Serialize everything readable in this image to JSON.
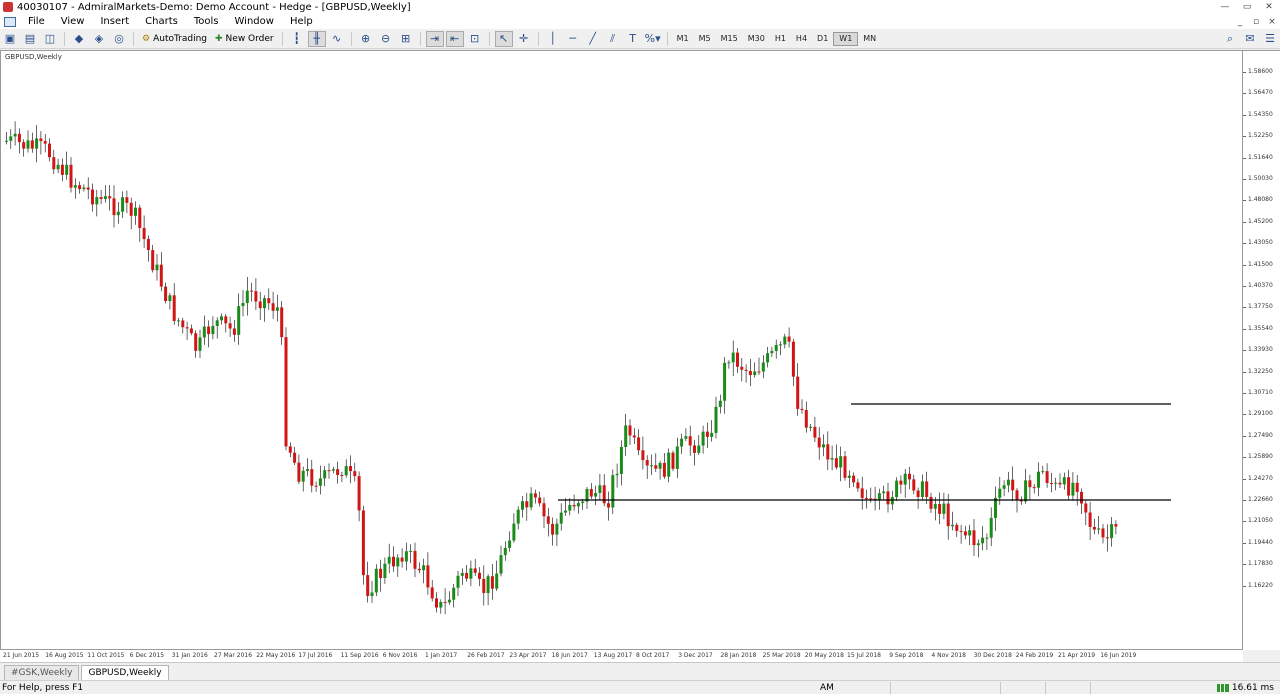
{
  "window": {
    "title": "40030107 - AdmiralMarkets-Demo: Demo Account - Hedge - [GBPUSD,Weekly]",
    "controls": {
      "minimize": "—",
      "maximize": "▭",
      "close": "✕"
    },
    "mdi_controls": {
      "minimize": "_",
      "restore": "▫",
      "close": "×"
    }
  },
  "menu": {
    "items": [
      "File",
      "View",
      "Insert",
      "Charts",
      "Tools",
      "Window",
      "Help"
    ]
  },
  "toolbar": {
    "autotrading_label": "AutoTrading",
    "new_order_label": "New Order",
    "timeframes": [
      "M1",
      "M5",
      "M15",
      "M30",
      "H1",
      "H4",
      "D1",
      "W1",
      "MN"
    ],
    "active_timeframe": "W1"
  },
  "chart": {
    "label": "GBPUSD,Weekly",
    "colors": {
      "bull": "#1a8a1a",
      "bear": "#d01515",
      "wick": "#000000",
      "line": "#000000",
      "background": "#ffffff"
    },
    "price_labels": [
      "1.58600",
      "1.56470",
      "1.54350",
      "1.52250",
      "1.51640",
      "1.50030",
      "1.48080",
      "1.45200",
      "1.43050",
      "1.41500",
      "1.40370",
      "1.37750",
      "1.35540",
      "1.33930",
      "1.32250",
      "1.30710",
      "1.29100",
      "1.27490",
      "1.25890",
      "1.24270",
      "1.22660",
      "1.21050",
      "1.19440",
      "1.17830",
      "1.16220"
    ],
    "date_labels": [
      "21 Jun 2015",
      "16 Aug 2015",
      "11 Oct 2015",
      "6 Dec 2015",
      "31 Jan 2016",
      "27 Mar 2016",
      "22 May 2016",
      "17 Jul 2016",
      "11 Sep 2016",
      "6 Nov 2016",
      "1 Jan 2017",
      "26 Feb 2017",
      "23 Apr 2017",
      "18 Jun 2017",
      "13 Aug 2017",
      "8 Oct 2017",
      "3 Dec 2017",
      "28 Jan 2018",
      "25 Mar 2018",
      "20 May 2018",
      "15 Jul 2018",
      "9 Sep 2018",
      "4 Nov 2018",
      "30 Dec 2018",
      "24 Feb 2019",
      "21 Apr 2019",
      "16 Jun 2019"
    ]
  },
  "tabs": [
    "#GSK,Weekly",
    "GBPUSD,Weekly"
  ],
  "active_tab": "GBPUSD,Weekly",
  "status": {
    "help": "For Help, press F1",
    "profile": "AM",
    "ping": "16.61 ms"
  }
}
